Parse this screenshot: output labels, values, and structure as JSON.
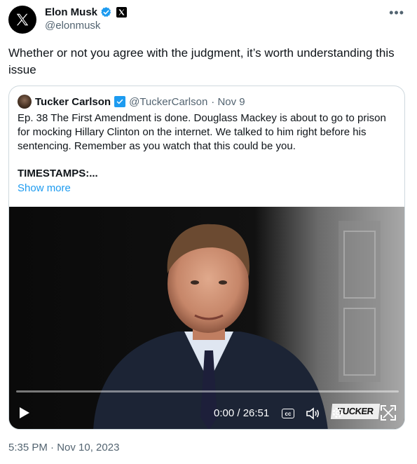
{
  "author": {
    "name": "Elon Musk",
    "handle": "@elonmusk"
  },
  "tweet": {
    "text": "Whether or not you agree with the judgment, it’s worth understanding this issue",
    "timestamp": "5:35 PM · Nov 10, 2023"
  },
  "quoted": {
    "name": "Tucker Carlson",
    "handle": "@TuckerCarlson",
    "date": "· Nov 9",
    "body": "Ep. 38  The First Amendment is done. Douglass Mackey is about to go to prison for mocking Hillary Clinton on the internet. We talked to him right before his sentencing. Remember as you watch that this could be you.",
    "timestamps_label": "TIMESTAMPS:...",
    "show_more": "Show more"
  },
  "video": {
    "time": "0:00 / 26:51",
    "cc_label": "cc",
    "watermark": "TUCKER",
    "progress": 0
  },
  "colors": {
    "accent": "#1d9bf0",
    "muted": "#536471",
    "border": "#cfd9de"
  },
  "icons": [
    "x-logo-icon",
    "verified-badge-icon",
    "x-affiliation-icon",
    "more-icon",
    "play-icon",
    "cc-icon",
    "volume-icon",
    "settings-icon",
    "fullscreen-icon"
  ]
}
